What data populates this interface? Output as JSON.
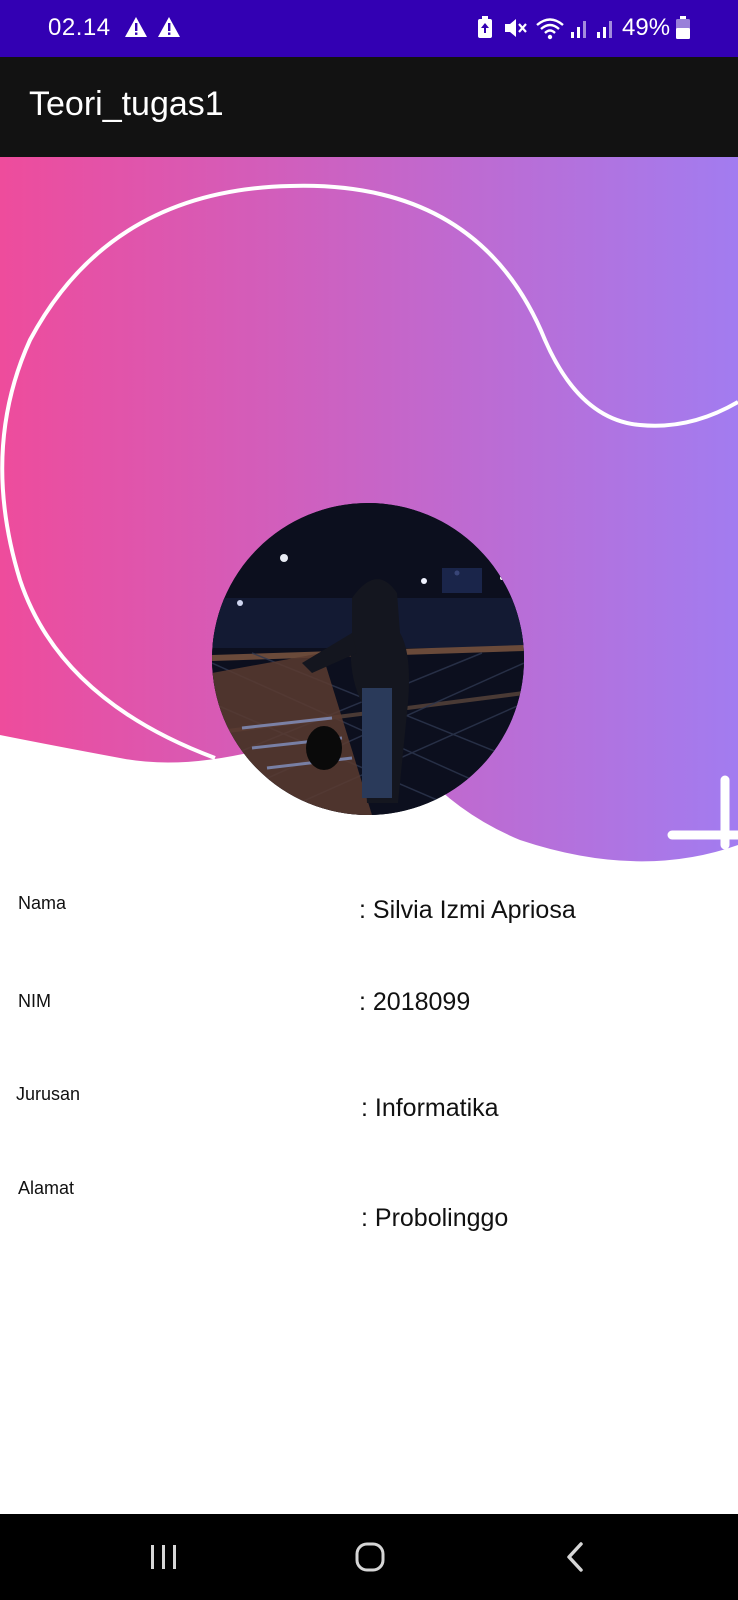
{
  "status_bar": {
    "time": "02.14",
    "battery_percent": "49%",
    "icons": [
      "warning-icon",
      "warning-icon",
      "battery-saver-icon",
      "mute-icon",
      "wifi-icon",
      "signal-icon",
      "signal-icon",
      "battery-icon"
    ],
    "background": "#3300b3"
  },
  "app_bar": {
    "title": "Teori_tugas1",
    "background": "#121212"
  },
  "header": {
    "gradient_start": "#ee4c9c",
    "gradient_end": "#a27cf0"
  },
  "profile": {
    "rows": [
      {
        "label": "Nama",
        "value": ": Silvia Izmi Apriosa"
      },
      {
        "label": "NIM",
        "value": ": 2018099"
      },
      {
        "label": "Jurusan",
        "value": ": Informatika"
      },
      {
        "label": "Alamat",
        "value": ": Probolinggo"
      }
    ]
  },
  "nav_bar": {
    "buttons": [
      "recent-apps-icon",
      "home-icon",
      "back-icon"
    ]
  }
}
